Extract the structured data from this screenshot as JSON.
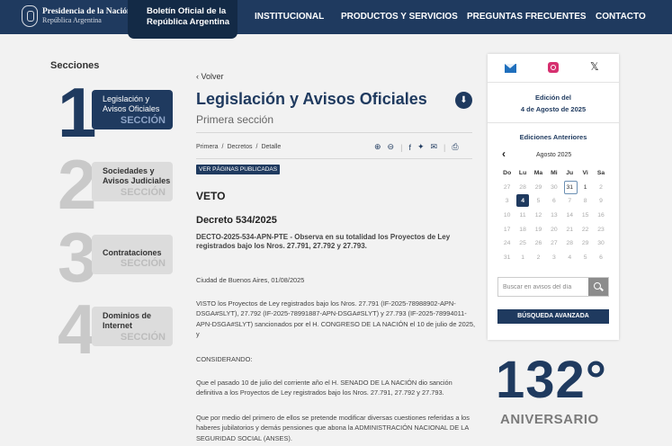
{
  "header": {
    "gov_title": "Presidencia de la Nación",
    "gov_sub": "República Argentina",
    "boletin_line1": "Boletín Oficial de la",
    "boletin_line2": "República Argentina",
    "nav": [
      "INSTITUCIONAL",
      "PRODUCTOS Y SERVICIOS",
      "PREGUNTAS FRECUENTES",
      "CONTACTO"
    ]
  },
  "sections": {
    "title": "Secciones",
    "items": [
      {
        "num": "1",
        "label1": "Legislación y",
        "label2": "Avisos Oficiales",
        "word": "SECCIÓN"
      },
      {
        "num": "2",
        "label1": "Sociedades y",
        "label2": "Avisos Judiciales",
        "word": "SECCIÓN"
      },
      {
        "num": "3",
        "label1": "",
        "label2": "Contrataciones",
        "word": "SECCIÓN"
      },
      {
        "num": "4",
        "label1": "Dominios de",
        "label2": "Internet",
        "word": "SECCIÓN"
      }
    ]
  },
  "main": {
    "back": "Volver",
    "title": "Legislación y Avisos Oficiales",
    "subtitle": "Primera sección",
    "breadcrumb": [
      "Primera",
      "Decretos",
      "Detalle"
    ],
    "badge": "VER PÁGINAS PUBLICADAS",
    "heading": "VETO",
    "decreto": "Decreto 534/2025",
    "decto": "DECTO-2025-534-APN-PTE - Observa en su totalidad los Proyectos de Ley registrados bajo los Nros. 27.791, 27.792 y 27.793.",
    "paragraphs": [
      "Ciudad de Buenos Aires, 01/08/2025",
      "VISTO los Proyectos de Ley registrados bajo los Nros. 27.791 (IF-2025-78988902-APN-DSGA#SLYT), 27.792 (IF-2025-78991887-APN-DSGA#SLYT) y 27.793 (IF-2025-78994011-APN-DSGA#SLYT) sancionados por el H. CONGRESO DE LA NACIÓN el 10 de julio de 2025, y",
      "CONSIDERANDO:",
      "Que el pasado 10 de julio del corriente año el H. SENADO DE LA NACIÓN dio sanción definitiva a los Proyectos de Ley registrados bajo los Nros. 27.791, 27.792 y 27.793.",
      "Que por medio del primero de ellos se pretende modificar diversas cuestiones referidas a los haberes jubilatorios y demás pensiones que abona la ADMINISTRACIÓN NACIONAL DE LA SEGURIDAD SOCIAL (ANSES)."
    ]
  },
  "panel": {
    "social_icons": [
      "mail-icon",
      "instagram-icon",
      "x-icon"
    ],
    "edition_label": "Edición del",
    "edition_date": "4 de Agosto de 2025",
    "previous_label": "Ediciones Anteriores",
    "month": "Agosto 2025",
    "weekdays": [
      "Do",
      "Lu",
      "Ma",
      "Mi",
      "Ju",
      "Vi",
      "Sa"
    ],
    "weeks": [
      [
        "27",
        "28",
        "29",
        "30",
        "31",
        "1",
        "2"
      ],
      [
        "3",
        "4",
        "5",
        "6",
        "7",
        "8",
        "9"
      ],
      [
        "10",
        "11",
        "12",
        "13",
        "14",
        "15",
        "16"
      ],
      [
        "17",
        "18",
        "19",
        "20",
        "21",
        "22",
        "23"
      ],
      [
        "24",
        "25",
        "26",
        "27",
        "28",
        "29",
        "30"
      ],
      [
        "31",
        "1",
        "2",
        "3",
        "4",
        "5",
        "6"
      ]
    ],
    "today_cell": "0-4",
    "selected_cell": "1-1",
    "current_cells": [
      "0-5"
    ],
    "search_placeholder": "Buscar en avisos del día",
    "advanced_label": "BÚSQUEDA AVANZADA"
  },
  "anniversary": {
    "number": "132°",
    "word": "ANIVERSARIO"
  },
  "colors": {
    "brand": "#1f3a5f",
    "topbar": "#1f3a5f",
    "accent_light": "#8ea4c7"
  }
}
